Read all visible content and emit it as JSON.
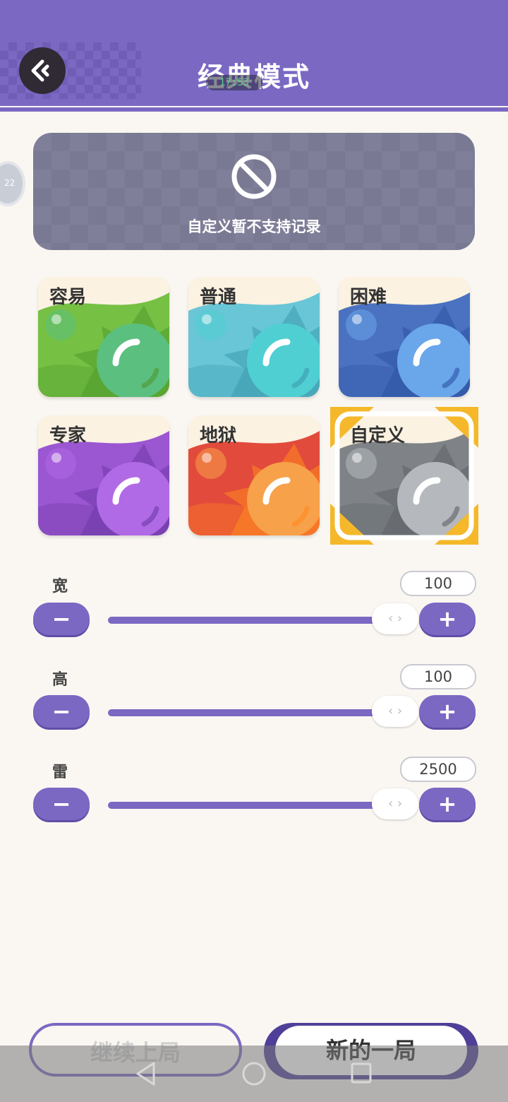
{
  "header": {
    "title": "经典模式",
    "timer": "17:53"
  },
  "side_badge": {
    "text": "22"
  },
  "notice": {
    "text": "自定义暂不支持记录"
  },
  "difficulties": [
    {
      "label": "容易",
      "colors": {
        "bg": "#76c043",
        "dark": "#4f9a2e",
        "ball": "#5bbf7f"
      }
    },
    {
      "label": "普通",
      "colors": {
        "bg": "#68c6d6",
        "dark": "#3d9bb0",
        "ball": "#4fcfd2"
      }
    },
    {
      "label": "困难",
      "colors": {
        "bg": "#4a72c0",
        "dark": "#2d54a3",
        "ball": "#6aa6ea"
      }
    },
    {
      "label": "专家",
      "colors": {
        "bg": "#9b56d2",
        "dark": "#6e3aa6",
        "ball": "#b06ae6"
      }
    },
    {
      "label": "地狱",
      "colors": {
        "bg": "#e24b3b",
        "dark": "#ff8a1f",
        "ball": "#f7a14a"
      }
    },
    {
      "label": "自定义",
      "colors": {
        "bg": "#7f8387",
        "dark": "#5f6367",
        "ball": "#b5b9bd"
      }
    }
  ],
  "selected_difficulty": "自定义",
  "sliders": [
    {
      "label": "宽",
      "value": "100",
      "minus": "−",
      "plus": "+",
      "thumb": "‹ ›"
    },
    {
      "label": "高",
      "value": "100",
      "minus": "−",
      "plus": "+",
      "thumb": "‹ ›"
    },
    {
      "label": "雷",
      "value": "2500",
      "minus": "−",
      "plus": "+",
      "thumb": "‹ ›"
    }
  ],
  "buttons": {
    "continue": "继续上局",
    "new_game": "新的一局"
  },
  "colors": {
    "accent": "#7b68c3",
    "background": "#faf7f2",
    "selection": "#f4b82a"
  }
}
